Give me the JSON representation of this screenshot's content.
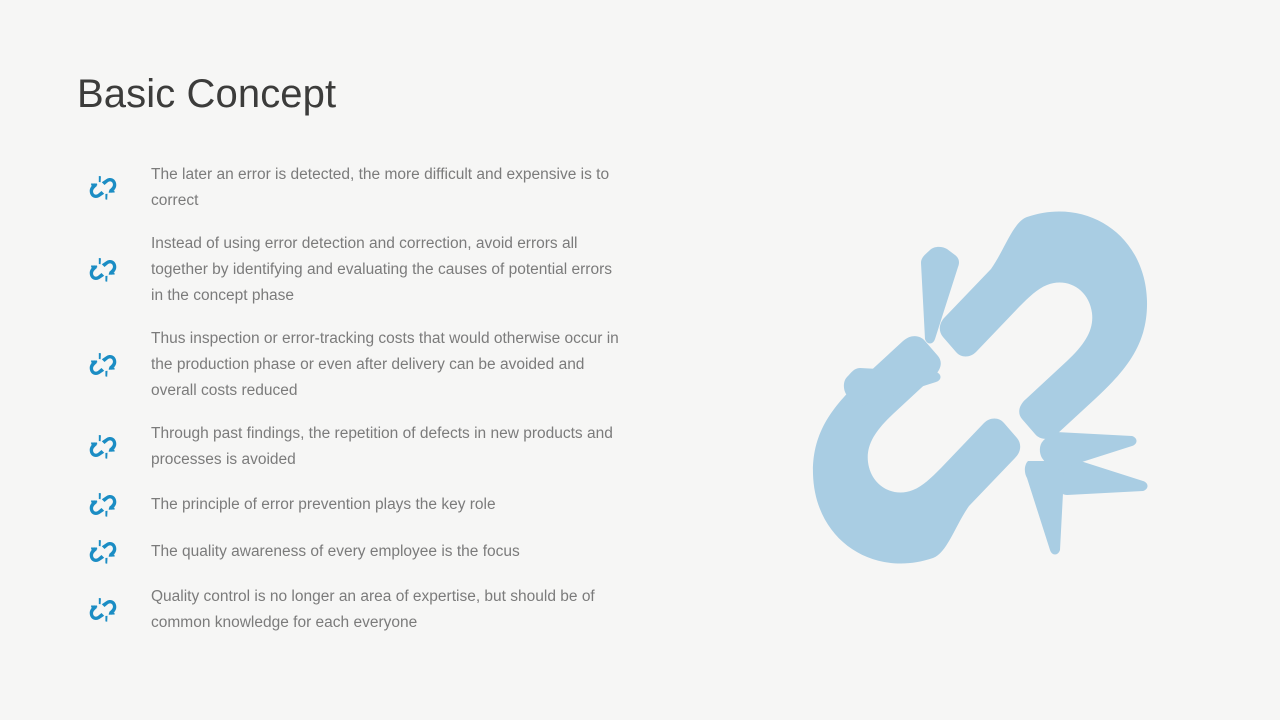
{
  "slide": {
    "title": "Basic Concept",
    "background_color": "#f6f6f5",
    "title_color": "#3c3c3b",
    "body_text_color": "#7b7b7b",
    "bullet_icon_color": "#1b8dc4",
    "graphic_color": "#a9cde3"
  },
  "bullets": [
    {
      "icon": "broken-chain-link-icon",
      "text": "The later an error is detected, the more difficult and expensive is to correct"
    },
    {
      "icon": "broken-chain-link-icon",
      "text": "Instead of using error detection and correction, avoid errors all together by identifying and evaluating the causes of potential errors in the concept phase"
    },
    {
      "icon": "broken-chain-link-icon",
      "text": "Thus inspection or error-tracking costs that would otherwise occur in the production phase or even after delivery can be avoided and overall costs reduced"
    },
    {
      "icon": "broken-chain-link-icon",
      "text": "Through past findings, the repetition of defects in new products and processes is avoided"
    },
    {
      "icon": "broken-chain-link-icon",
      "text": "The principle of error prevention plays the key role"
    },
    {
      "icon": "broken-chain-link-icon",
      "text": "The quality awareness of every employee is the focus"
    },
    {
      "icon": "broken-chain-link-icon",
      "text": "Quality control is no longer an area of expertise, but should be of common knowledge for each everyone"
    }
  ],
  "graphic": {
    "name": "broken-chain-link-illustration"
  }
}
